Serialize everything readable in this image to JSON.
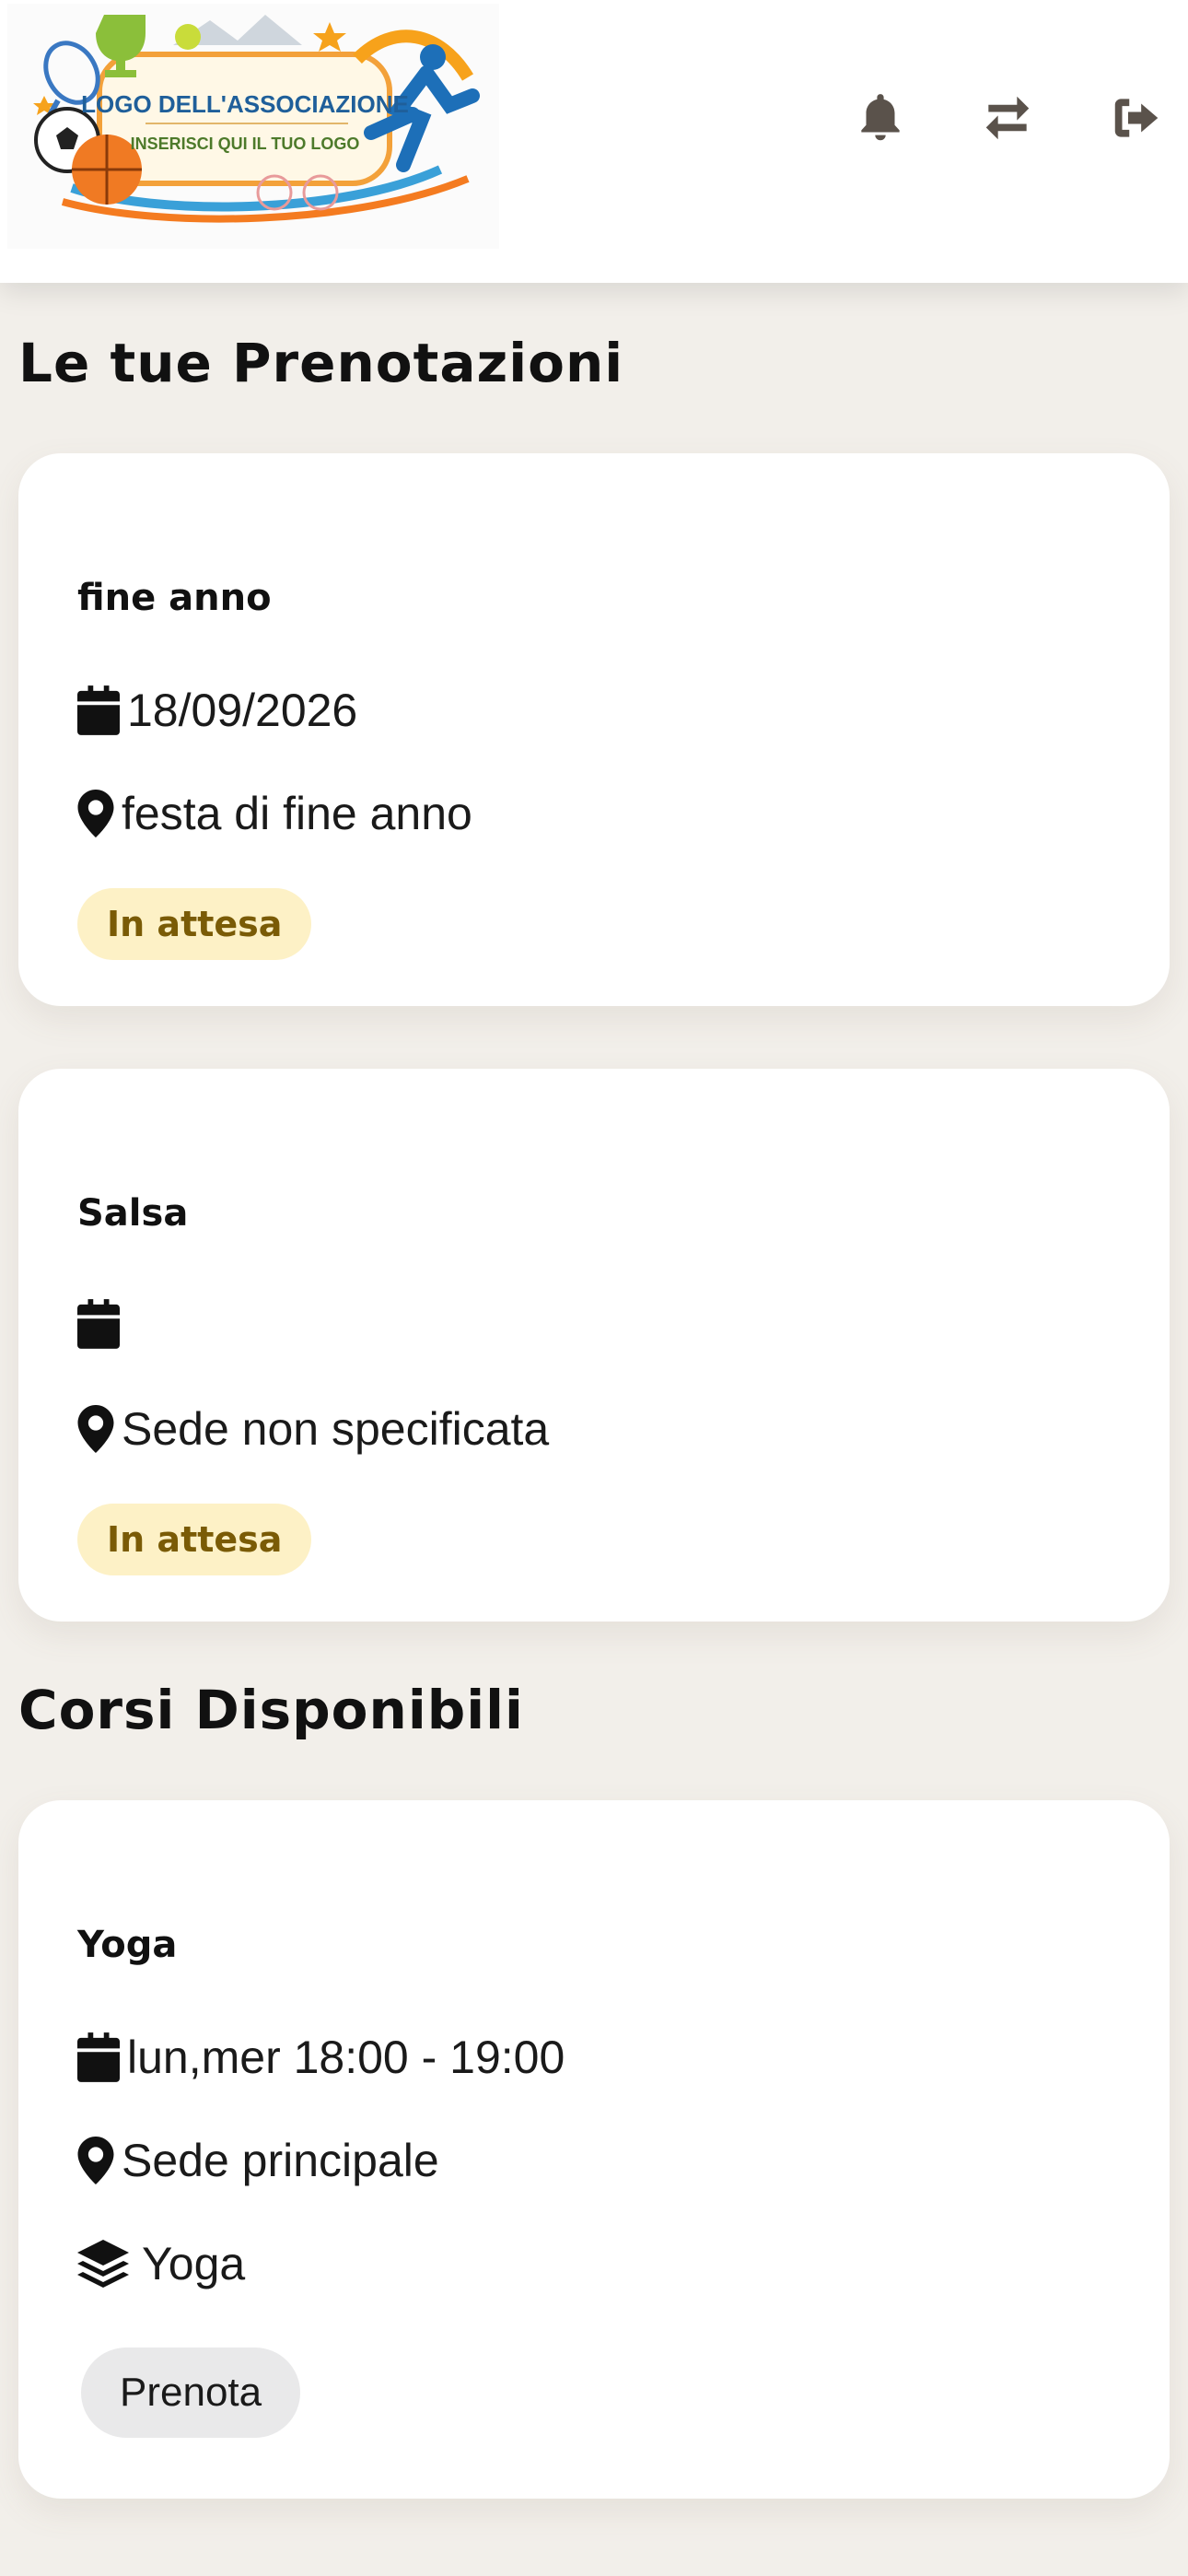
{
  "header": {
    "logo": {
      "line1": "LOGO DELL'ASSOCIAZIONE",
      "line2": "INSERISCI QUI IL TUO LOGO"
    },
    "icons": [
      "bell-icon",
      "swap-icon",
      "logout-icon"
    ]
  },
  "bookings": {
    "title": "Le tue Prenotazioni",
    "items": [
      {
        "name": "fine anno",
        "date": "18/09/2026",
        "location": "festa di fine anno",
        "status": "In attesa"
      },
      {
        "name": "Salsa",
        "date": "",
        "location": "Sede non specificata",
        "status": "In attesa"
      }
    ]
  },
  "courses": {
    "title": "Corsi Disponibili",
    "items": [
      {
        "name": "Yoga",
        "schedule": "lun,mer 18:00 - 19:00",
        "location": "Sede principale",
        "category": "Yoga",
        "action": "Prenota"
      }
    ]
  },
  "colors": {
    "background": "#f2efea",
    "card": "#ffffff",
    "badge_bg": "#fdf1c6",
    "badge_text": "#7a5b06",
    "icon": "#5a524b",
    "button_bg": "#e9e9ea"
  }
}
